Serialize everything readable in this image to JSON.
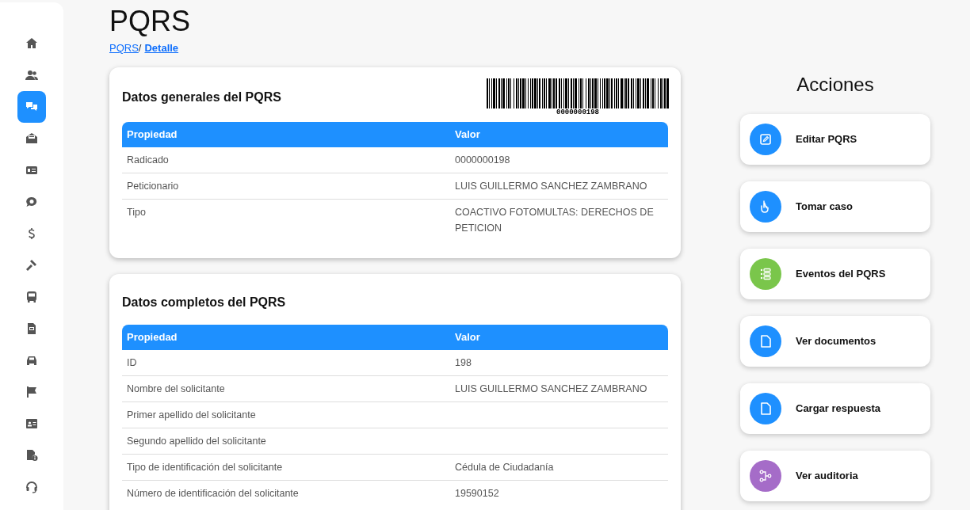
{
  "sidebar": {
    "items": [
      {
        "kind": "home",
        "selected": false
      },
      {
        "kind": "users",
        "selected": false
      },
      {
        "kind": "chat",
        "selected": true
      },
      {
        "kind": "inbox",
        "selected": false
      },
      {
        "kind": "card",
        "selected": false
      },
      {
        "kind": "bubble",
        "selected": false
      },
      {
        "kind": "dollar",
        "selected": false
      },
      {
        "kind": "gavel",
        "selected": false
      },
      {
        "kind": "bus",
        "selected": false
      },
      {
        "kind": "doc",
        "selected": false
      },
      {
        "kind": "car",
        "selected": false
      },
      {
        "kind": "flag",
        "selected": false
      },
      {
        "kind": "idcard",
        "selected": false
      },
      {
        "kind": "fileinfo",
        "selected": false
      },
      {
        "kind": "headset",
        "selected": false
      }
    ]
  },
  "page": {
    "title": "PQRS",
    "breadcrumb_separator": "/",
    "breadcrumb": [
      {
        "label": "PQRS",
        "current": false
      },
      {
        "label": "Detalle",
        "current": true
      }
    ]
  },
  "general_card": {
    "title": "Datos generales del PQRS",
    "barcode": "0000000198",
    "columns": [
      "Propiedad",
      "Valor"
    ],
    "rows": [
      [
        "Radicado",
        "0000000198"
      ],
      [
        "Peticionario",
        "LUIS GUILLERMO SANCHEZ ZAMBRANO"
      ],
      [
        "Tipo",
        "COACTIVO FOTOMULTAS: DERECHOS DE PETICION"
      ]
    ]
  },
  "full_card": {
    "title": "Datos completos del PQRS",
    "columns": [
      "Propiedad",
      "Valor"
    ],
    "rows": [
      [
        "ID",
        "198"
      ],
      [
        "Nombre del solicitante",
        "LUIS GUILLERMO SANCHEZ ZAMBRANO"
      ],
      [
        "Primer apellido del solicitante",
        ""
      ],
      [
        "Segundo apellido del solicitante",
        ""
      ],
      [
        "Tipo de identificación del solicitante",
        "Cédula de Ciudadanía"
      ],
      [
        "Número de identificación del solicitante",
        "19590152"
      ]
    ]
  },
  "actions": {
    "title": "Acciones",
    "items": [
      {
        "label": "Editar PQRS",
        "kind": "edit",
        "color": "#1e90ff"
      },
      {
        "label": "Tomar caso",
        "kind": "hand",
        "color": "#1e90ff"
      },
      {
        "label": "Eventos del PQRS",
        "kind": "list",
        "color": "#7ac64b"
      },
      {
        "label": "Ver documentos",
        "kind": "file",
        "color": "#1e90ff"
      },
      {
        "label": "Cargar respuesta",
        "kind": "file",
        "color": "#1e90ff"
      },
      {
        "label": "Ver auditoria",
        "kind": "tree",
        "color": "#a56cc8"
      }
    ]
  }
}
